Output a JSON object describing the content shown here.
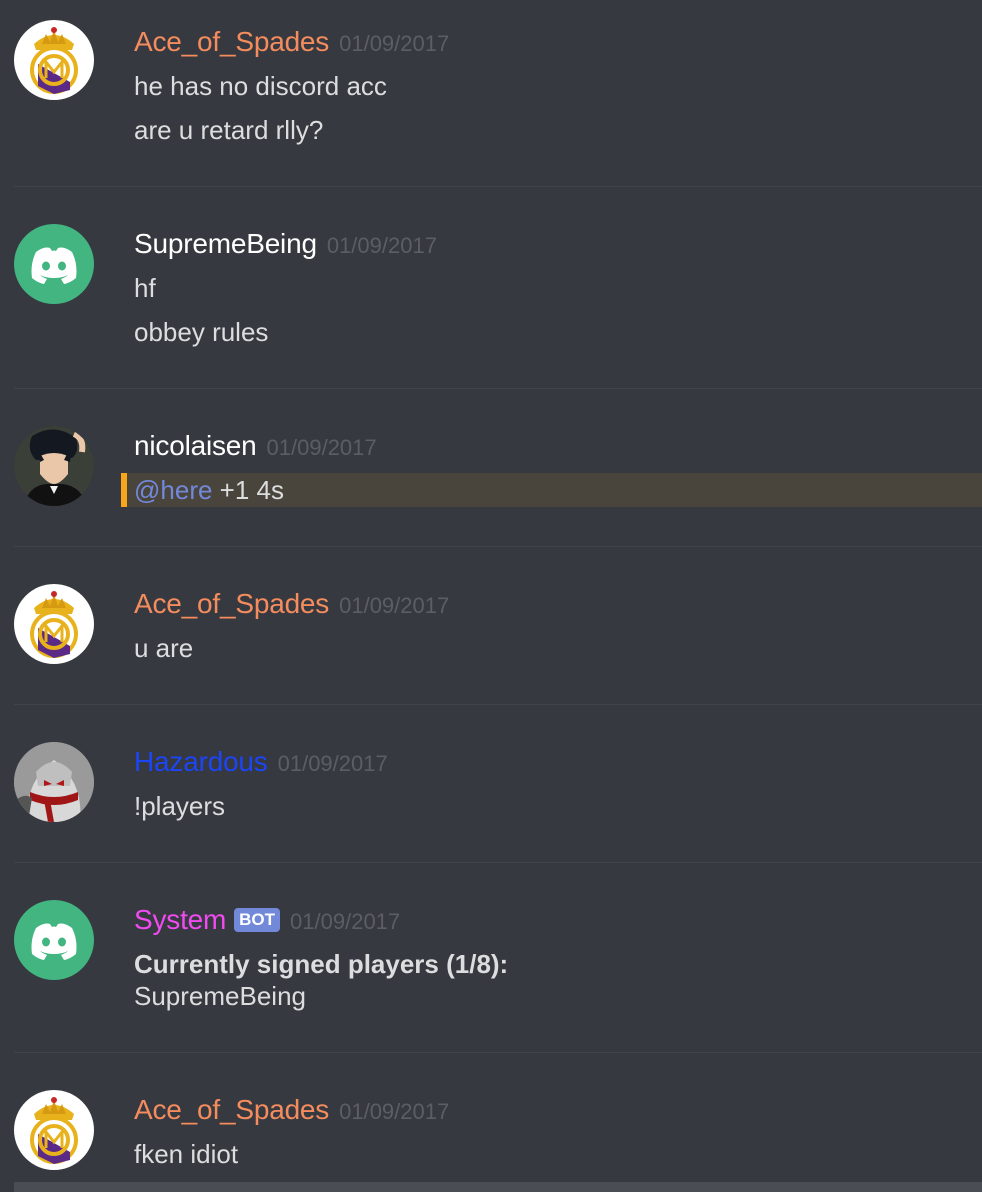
{
  "messages": [
    {
      "author": "Ace_of_Spades",
      "author_color": "#f48c5e",
      "avatar": "real-madrid-crest-avatar",
      "timestamp": "01/09/2017",
      "lines": [
        "he has no discord acc",
        "are u retard rlly?"
      ]
    },
    {
      "author": "SupremeBeing",
      "author_color": "#ffffff",
      "avatar": "discord-default-avatar",
      "timestamp": "01/09/2017",
      "lines": [
        "hf",
        "obbey rules"
      ]
    },
    {
      "author": "nicolaisen",
      "author_color": "#ffffff",
      "avatar": "anime-character-avatar",
      "timestamp": "01/09/2017",
      "mention": "@here",
      "mention_rest": " +1 4s"
    },
    {
      "author": "Ace_of_Spades",
      "author_color": "#f48c5e",
      "avatar": "real-madrid-crest-avatar",
      "timestamp": "01/09/2017",
      "lines": [
        "u are"
      ]
    },
    {
      "author": "Hazardous",
      "author_color": "#1b45f5",
      "avatar": "masked-figure-avatar",
      "timestamp": "01/09/2017",
      "lines": [
        "!players"
      ]
    },
    {
      "author": "System",
      "author_color": "#f04bf0",
      "avatar": "discord-default-avatar",
      "bot_tag": "BOT",
      "timestamp": "01/09/2017",
      "bold_line": "Currently signed players (1/8):",
      "lines": [
        "SupremeBeing"
      ]
    },
    {
      "author": "Ace_of_Spades",
      "author_color": "#f48c5e",
      "avatar": "real-madrid-crest-avatar",
      "timestamp": "01/09/2017",
      "lines": [
        "fken idiot"
      ]
    }
  ],
  "colors": {
    "background": "#36393f",
    "timestamp": "#5b5e63",
    "mention_highlight": "#49443c",
    "mention_bar": "#faa61a",
    "mention_text": "#7289da",
    "discord_green": "#43b581",
    "bot_tag": "#7289da"
  }
}
